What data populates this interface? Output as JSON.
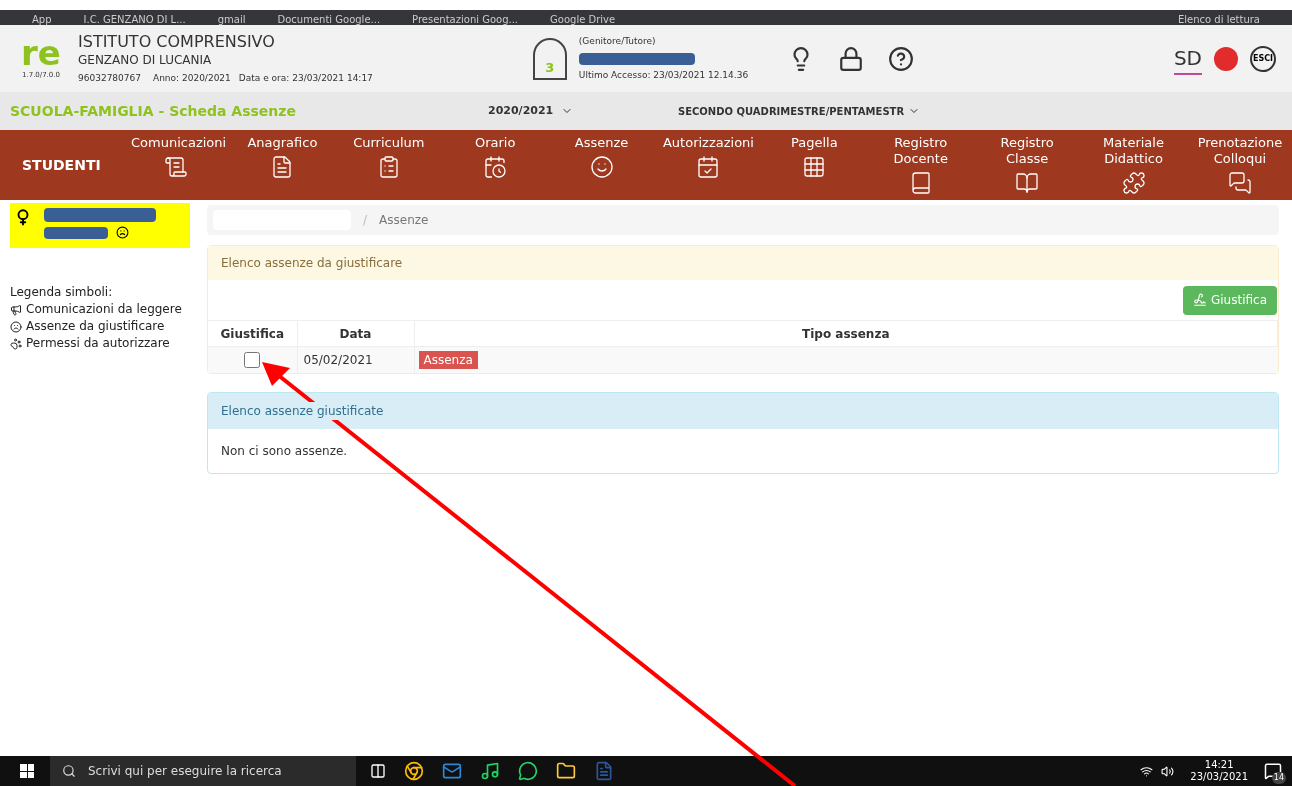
{
  "browser_bar": {
    "bookmarks": [
      "App",
      "I.C. GENZANO DI L...",
      "gmail",
      "Documenti Google...",
      "Presentazioni Goog...",
      "Google Drive"
    ],
    "reading_list": "Elenco di lettura"
  },
  "header": {
    "logo": "re",
    "version": "1.7.0/7.0.0",
    "title": "ISTITUTO COMPRENSIVO",
    "subtitle": "GENZANO DI LUCANIA",
    "code": "96032780767",
    "year": "Anno: 2020/2021",
    "datetime": "Data e ora: 23/03/2021 14:17",
    "user_badge": "3",
    "user_role": "(Genitore/Tutore)",
    "last_access": "Ultimo Accesso: 23/03/2021 12.14.36",
    "sd_logo": "SD",
    "exit": "ESCI"
  },
  "title_bar": {
    "title": "SCUOLA-FAMIGLIA - Scheda Assenze",
    "year": "2020/2021",
    "period": "SECONDO QUADRIMESTRE/PENTAMESTR"
  },
  "nav": {
    "section": "STUDENTI",
    "items": [
      {
        "label": "Comunicazioni"
      },
      {
        "label": "Anagrafico"
      },
      {
        "label": "Curriculum"
      },
      {
        "label": "Orario"
      },
      {
        "label": "Assenze"
      },
      {
        "label": "Autorizzazioni"
      },
      {
        "label": "Pagella"
      },
      {
        "label": "Registro Docente"
      },
      {
        "label": "Registro Classe"
      },
      {
        "label": "Materiale Didattico"
      },
      {
        "label": "Prenotazione Colloqui"
      }
    ]
  },
  "legend": {
    "title": "Legenda simboli:",
    "items": [
      {
        "kind": "megaphone",
        "label": "Comunicazioni da leggere"
      },
      {
        "kind": "frown",
        "label": "Assenze da giustificare"
      },
      {
        "kind": "paw",
        "label": "Permessi da autorizzare"
      }
    ]
  },
  "breadcrumb_separator": "/",
  "breadcrumb": "Assenze",
  "pending": {
    "title": "Elenco assenze da giustificare",
    "button": "Giustifica",
    "columns": [
      "Giustifica",
      "Data",
      "Tipo assenza"
    ],
    "rows": [
      {
        "checked": false,
        "date": "05/02/2021",
        "type": "Assenza"
      }
    ]
  },
  "justified": {
    "title": "Elenco assenze giustificate",
    "message": "Non ci sono assenze."
  },
  "taskbar": {
    "search_placeholder": "Scrivi qui per eseguire la ricerca",
    "time": "14:21",
    "date": "23/03/2021",
    "notifications": "14"
  }
}
